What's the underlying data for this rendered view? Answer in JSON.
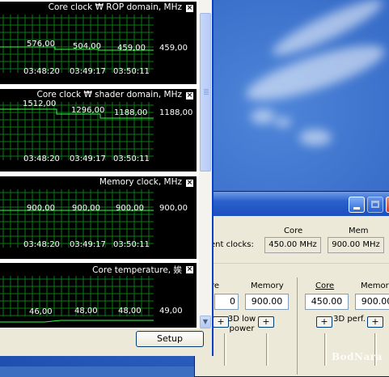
{
  "graphs": [
    {
      "title": "Core clock ₩ ROP domain, MHz",
      "values": [
        "576,00",
        "504,00",
        "459,00"
      ],
      "current": "459,00",
      "times": [
        "03:48:20",
        "03:49:17",
        "03:50:11"
      ]
    },
    {
      "title": "Core clock ₩ shader domain, MHz",
      "values": [
        "1512,00",
        "1296,00",
        "1188,00"
      ],
      "current": "1188,00",
      "times": [
        "03:48:20",
        "03:49:17",
        "03:50:11"
      ]
    },
    {
      "title": "Memory clock, MHz",
      "values": [
        "900,00",
        "900,00",
        "900,00"
      ],
      "current": "900,00",
      "times": [
        "03:48:20",
        "03:49:17",
        "03:50:11"
      ]
    },
    {
      "title": "Core temperature, 娭",
      "values": [
        "46,00",
        "48,00",
        "48,00"
      ],
      "current": "49,00"
    }
  ],
  "graph_close_glyph": "×",
  "setup_button": "Setup",
  "back_window": {
    "col_core": "Core",
    "col_mem": "Mem",
    "current_clocks_label": "ent clocks:",
    "current_core": "450.00 MHz",
    "current_mem": "900.00 MHz",
    "left_core_partial": "re",
    "left_memory_label": "Memory",
    "left_memory_value": "900.00",
    "left_core_value_partial": "0",
    "mode_3d_low_power": "3D low power",
    "right_core_label": "Core",
    "right_core_value": "450.00",
    "right_memory_label": "Memory",
    "right_memory_value": "900.00",
    "mode_3d_perf": "3D perf.",
    "plus": "+"
  },
  "watermark": "BodNara",
  "colors": {
    "graph_bg": "#000000",
    "grid": "#0a7a18",
    "trace": "#33ff44",
    "titlebar": "#2a5fcc"
  }
}
